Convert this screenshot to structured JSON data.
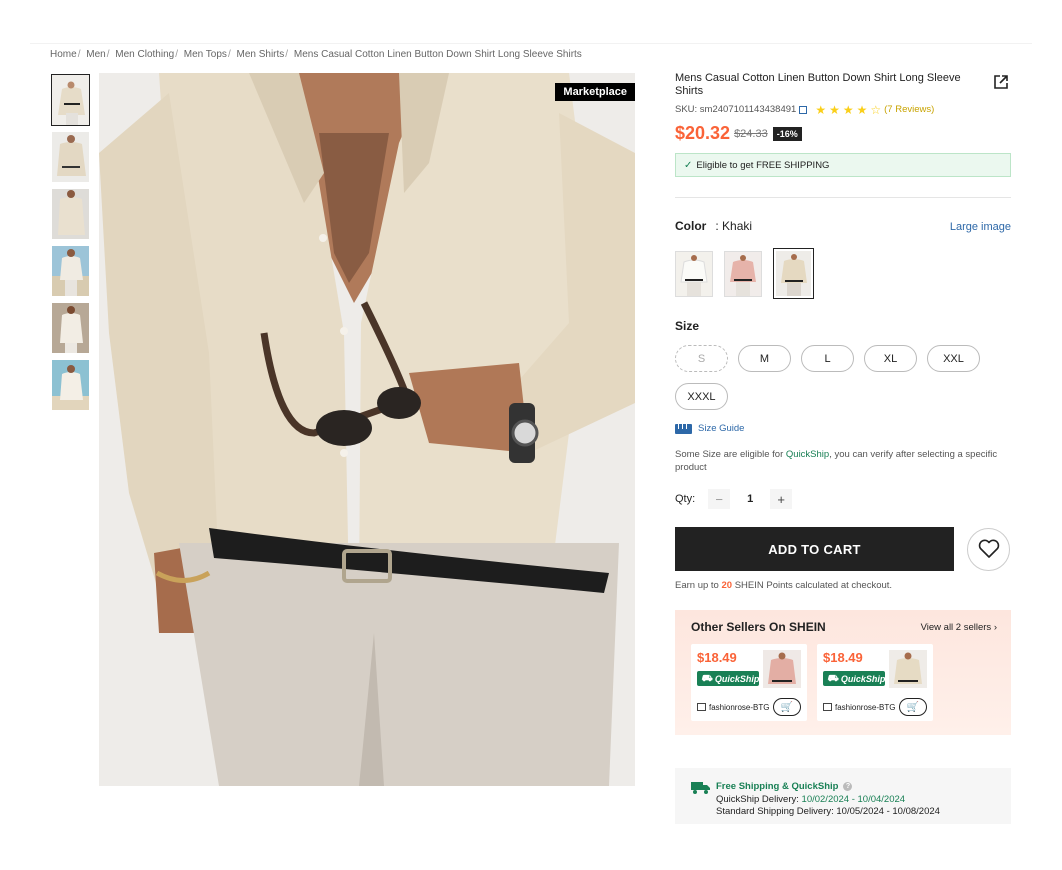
{
  "breadcrumb": [
    "Home",
    "Men",
    "Men Clothing",
    "Men Tops",
    "Men Shirts",
    "Mens Casual Cotton Linen Button Down Shirt Long Sleeve Shirts"
  ],
  "gallery": {
    "badge": "Marketplace",
    "thumb_count": 6,
    "active_thumb": 0
  },
  "product": {
    "title": "Mens Casual Cotton Linen Button Down Shirt Long Sleeve Shirts",
    "sku": "SKU: sm2407101143438491",
    "rating": 4.5,
    "reviews": "(7 Reviews)",
    "price": "$20.32",
    "old_price": "$24.33",
    "discount": "-16%",
    "free_shipping": "Eligible to get FREE SHIPPING"
  },
  "color": {
    "label": "Color",
    "value": ": Khaki",
    "large_image": "Large image",
    "swatches": [
      "white",
      "pink",
      "khaki"
    ],
    "selected": "khaki"
  },
  "size": {
    "label": "Size",
    "options": [
      "S",
      "M",
      "L",
      "XL",
      "XXL",
      "XXXL"
    ],
    "disabled": [
      "S"
    ],
    "guide": "Size Guide",
    "note_prefix": "Some Size are eligible for ",
    "note_link": "QuickShip",
    "note_suffix": ", you can verify after selecting a specific product"
  },
  "qty": {
    "label": "Qty:",
    "value": "1",
    "minus": "−",
    "plus": "+"
  },
  "cart": {
    "add_label": "ADD TO CART",
    "points_prefix": "Earn up to ",
    "points_value": "20",
    "points_suffix": " SHEIN Points calculated at checkout."
  },
  "sellers": {
    "title": "Other Sellers On SHEIN",
    "view_all": "View all 2 sellers ›",
    "cards": [
      {
        "price": "$18.49",
        "badge": "QuickShip",
        "store": "fashionrose-BTG",
        "shirt": "pink"
      },
      {
        "price": "$18.49",
        "badge": "QuickShip",
        "store": "fashionrose-BTG",
        "shirt": "khaki"
      }
    ]
  },
  "delivery": {
    "title": "Free Shipping & QuickShip",
    "quick_label": "QuickShip Delivery: ",
    "quick_dates": "10/02/2024 - 10/04/2024",
    "standard": "Standard Shipping Delivery: 10/05/2024 - 10/08/2024"
  },
  "colors": {
    "accent_price": "#fa6338",
    "link_blue": "#2d68a8",
    "green": "#198055",
    "dark": "#222222"
  }
}
